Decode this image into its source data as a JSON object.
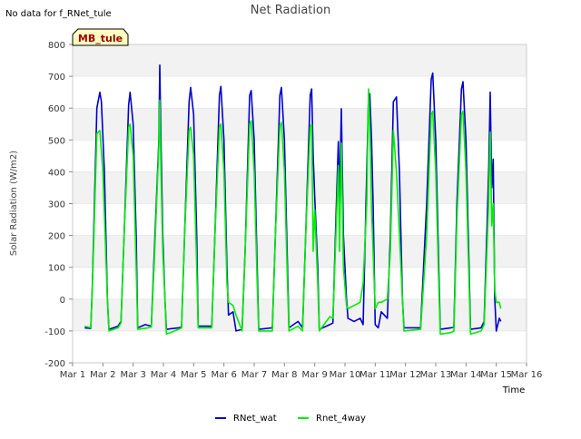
{
  "corner_note": "No data for f_RNet_tule",
  "site_badge": "MB_tule",
  "chart_data": {
    "type": "line",
    "title": "Net Radiation",
    "xlabel": "Time",
    "ylabel": "Solar Radiation (W/m2)",
    "xlim": [
      1,
      16
    ],
    "ylim": [
      -200,
      800
    ],
    "x_ticks": [
      "Mar 1",
      "Mar 2",
      "Mar 3",
      "Mar 4",
      "Mar 5",
      "Mar 6",
      "Mar 7",
      "Mar 8",
      "Mar 9",
      "Mar 10",
      "Mar 11",
      "Mar 12",
      "Mar 13",
      "Mar 14",
      "Mar 15",
      "Mar 16"
    ],
    "y_ticks": [
      -200,
      -100,
      0,
      100,
      200,
      300,
      400,
      500,
      600,
      700,
      800
    ],
    "grid": "horizontal bands",
    "legend_position": "bottom-center",
    "series": [
      {
        "name": "RNet_wat",
        "color": "#0000cc",
        "points": [
          [
            1.4,
            -90
          ],
          [
            1.6,
            -92
          ],
          [
            1.65,
            40
          ],
          [
            1.8,
            600
          ],
          [
            1.9,
            650
          ],
          [
            1.95,
            620
          ],
          [
            2.05,
            400
          ],
          [
            2.15,
            0
          ],
          [
            2.2,
            -95
          ],
          [
            2.5,
            -85
          ],
          [
            2.6,
            -70
          ],
          [
            2.7,
            200
          ],
          [
            2.85,
            610
          ],
          [
            2.9,
            650
          ],
          [
            3.0,
            550
          ],
          [
            3.1,
            200
          ],
          [
            3.15,
            -90
          ],
          [
            3.4,
            -80
          ],
          [
            3.6,
            -85
          ],
          [
            3.7,
            150
          ],
          [
            3.85,
            500
          ],
          [
            3.88,
            735
          ],
          [
            3.92,
            500
          ],
          [
            3.98,
            200
          ],
          [
            4.05,
            0
          ],
          [
            4.1,
            -95
          ],
          [
            4.5,
            -90
          ],
          [
            4.6,
            -88
          ],
          [
            4.7,
            200
          ],
          [
            4.85,
            620
          ],
          [
            4.9,
            665
          ],
          [
            5.0,
            580
          ],
          [
            5.1,
            200
          ],
          [
            5.15,
            -85
          ],
          [
            5.6,
            -85
          ],
          [
            5.7,
            200
          ],
          [
            5.85,
            640
          ],
          [
            5.9,
            668
          ],
          [
            6.0,
            500
          ],
          [
            6.1,
            100
          ],
          [
            6.15,
            -50
          ],
          [
            6.3,
            -40
          ],
          [
            6.4,
            -100
          ],
          [
            6.6,
            -95
          ],
          [
            6.7,
            150
          ],
          [
            6.85,
            640
          ],
          [
            6.9,
            655
          ],
          [
            7.0,
            500
          ],
          [
            7.1,
            100
          ],
          [
            7.15,
            -95
          ],
          [
            7.6,
            -90
          ],
          [
            7.7,
            200
          ],
          [
            7.85,
            640
          ],
          [
            7.9,
            665
          ],
          [
            8.0,
            500
          ],
          [
            8.1,
            100
          ],
          [
            8.15,
            -90
          ],
          [
            8.45,
            -70
          ],
          [
            8.6,
            -90
          ],
          [
            8.7,
            200
          ],
          [
            8.85,
            640
          ],
          [
            8.9,
            660
          ],
          [
            8.95,
            450
          ],
          [
            9.0,
            320
          ],
          [
            9.1,
            100
          ],
          [
            9.15,
            -95
          ],
          [
            9.5,
            -80
          ],
          [
            9.6,
            -75
          ],
          [
            9.7,
            250
          ],
          [
            9.78,
            495
          ],
          [
            9.82,
            300
          ],
          [
            9.88,
            598
          ],
          [
            9.95,
            200
          ],
          [
            10.05,
            0
          ],
          [
            10.1,
            -60
          ],
          [
            10.3,
            -70
          ],
          [
            10.5,
            -60
          ],
          [
            10.6,
            -80
          ],
          [
            10.72,
            400
          ],
          [
            10.78,
            640
          ],
          [
            10.82,
            645
          ],
          [
            10.88,
            500
          ],
          [
            10.93,
            300
          ],
          [
            11.0,
            -80
          ],
          [
            11.1,
            -90
          ],
          [
            11.2,
            -40
          ],
          [
            11.4,
            -60
          ],
          [
            11.5,
            200
          ],
          [
            11.6,
            620
          ],
          [
            11.7,
            635
          ],
          [
            11.8,
            400
          ],
          [
            11.9,
            0
          ],
          [
            11.95,
            -90
          ],
          [
            12.5,
            -90
          ],
          [
            12.7,
            300
          ],
          [
            12.85,
            690
          ],
          [
            12.9,
            710
          ],
          [
            13.0,
            500
          ],
          [
            13.1,
            100
          ],
          [
            13.15,
            -95
          ],
          [
            13.5,
            -90
          ],
          [
            13.6,
            -88
          ],
          [
            13.7,
            300
          ],
          [
            13.85,
            660
          ],
          [
            13.9,
            683
          ],
          [
            14.0,
            500
          ],
          [
            14.1,
            100
          ],
          [
            14.15,
            -95
          ],
          [
            14.5,
            -90
          ],
          [
            14.6,
            -70
          ],
          [
            14.75,
            400
          ],
          [
            14.8,
            650
          ],
          [
            14.85,
            350
          ],
          [
            14.9,
            440
          ],
          [
            14.95,
            0
          ],
          [
            15.0,
            -100
          ],
          [
            15.1,
            -60
          ],
          [
            15.15,
            -70
          ]
        ]
      },
      {
        "name": "Rnet_4way",
        "color": "#00ee00",
        "points": [
          [
            1.4,
            -85
          ],
          [
            1.6,
            -90
          ],
          [
            1.65,
            30
          ],
          [
            1.8,
            520
          ],
          [
            1.9,
            530
          ],
          [
            2.0,
            400
          ],
          [
            2.15,
            0
          ],
          [
            2.2,
            -100
          ],
          [
            2.5,
            -90
          ],
          [
            2.6,
            -75
          ],
          [
            2.7,
            200
          ],
          [
            2.85,
            540
          ],
          [
            2.9,
            550
          ],
          [
            3.0,
            450
          ],
          [
            3.1,
            100
          ],
          [
            3.15,
            -95
          ],
          [
            3.5,
            -90
          ],
          [
            3.6,
            -88
          ],
          [
            3.7,
            120
          ],
          [
            3.85,
            480
          ],
          [
            3.88,
            625
          ],
          [
            3.92,
            400
          ],
          [
            3.98,
            150
          ],
          [
            4.05,
            0
          ],
          [
            4.1,
            -110
          ],
          [
            4.5,
            -95
          ],
          [
            4.6,
            -90
          ],
          [
            4.7,
            200
          ],
          [
            4.85,
            530
          ],
          [
            4.9,
            540
          ],
          [
            5.0,
            450
          ],
          [
            5.1,
            100
          ],
          [
            5.15,
            -90
          ],
          [
            5.6,
            -90
          ],
          [
            5.7,
            200
          ],
          [
            5.85,
            540
          ],
          [
            5.9,
            550
          ],
          [
            6.0,
            400
          ],
          [
            6.1,
            50
          ],
          [
            6.15,
            -10
          ],
          [
            6.3,
            -20
          ],
          [
            6.4,
            -50
          ],
          [
            6.6,
            -100
          ],
          [
            6.7,
            150
          ],
          [
            6.85,
            550
          ],
          [
            6.9,
            560
          ],
          [
            7.0,
            400
          ],
          [
            7.1,
            50
          ],
          [
            7.15,
            -100
          ],
          [
            7.6,
            -100
          ],
          [
            7.7,
            200
          ],
          [
            7.85,
            545
          ],
          [
            7.9,
            555
          ],
          [
            8.0,
            400
          ],
          [
            8.1,
            50
          ],
          [
            8.15,
            -100
          ],
          [
            8.45,
            -85
          ],
          [
            8.6,
            -100
          ],
          [
            8.7,
            200
          ],
          [
            8.85,
            540
          ],
          [
            8.9,
            550
          ],
          [
            8.95,
            150
          ],
          [
            9.0,
            280
          ],
          [
            9.1,
            50
          ],
          [
            9.15,
            -100
          ],
          [
            9.5,
            -55
          ],
          [
            9.6,
            -60
          ],
          [
            9.7,
            200
          ],
          [
            9.78,
            420
          ],
          [
            9.82,
            150
          ],
          [
            9.88,
            490
          ],
          [
            9.95,
            100
          ],
          [
            10.05,
            -20
          ],
          [
            10.1,
            -30
          ],
          [
            10.3,
            -20
          ],
          [
            10.5,
            -10
          ],
          [
            10.6,
            50
          ],
          [
            10.72,
            300
          ],
          [
            10.78,
            660
          ],
          [
            10.82,
            540
          ],
          [
            10.88,
            280
          ],
          [
            10.93,
            150
          ],
          [
            11.0,
            -30
          ],
          [
            11.1,
            -10
          ],
          [
            11.2,
            -10
          ],
          [
            11.4,
            0
          ],
          [
            11.5,
            150
          ],
          [
            11.6,
            530
          ],
          [
            11.7,
            400
          ],
          [
            11.8,
            200
          ],
          [
            11.9,
            0
          ],
          [
            11.95,
            -100
          ],
          [
            12.5,
            -95
          ],
          [
            12.7,
            200
          ],
          [
            12.85,
            580
          ],
          [
            12.9,
            590
          ],
          [
            13.0,
            400
          ],
          [
            13.1,
            50
          ],
          [
            13.15,
            -110
          ],
          [
            13.5,
            -105
          ],
          [
            13.6,
            -100
          ],
          [
            13.7,
            250
          ],
          [
            13.85,
            580
          ],
          [
            13.9,
            590
          ],
          [
            14.0,
            400
          ],
          [
            14.1,
            50
          ],
          [
            14.15,
            -110
          ],
          [
            14.5,
            -100
          ],
          [
            14.6,
            -80
          ],
          [
            14.75,
            300
          ],
          [
            14.8,
            525
          ],
          [
            14.85,
            230
          ],
          [
            14.9,
            300
          ],
          [
            14.95,
            30
          ],
          [
            15.0,
            -10
          ],
          [
            15.1,
            -10
          ],
          [
            15.15,
            -30
          ]
        ]
      }
    ]
  }
}
